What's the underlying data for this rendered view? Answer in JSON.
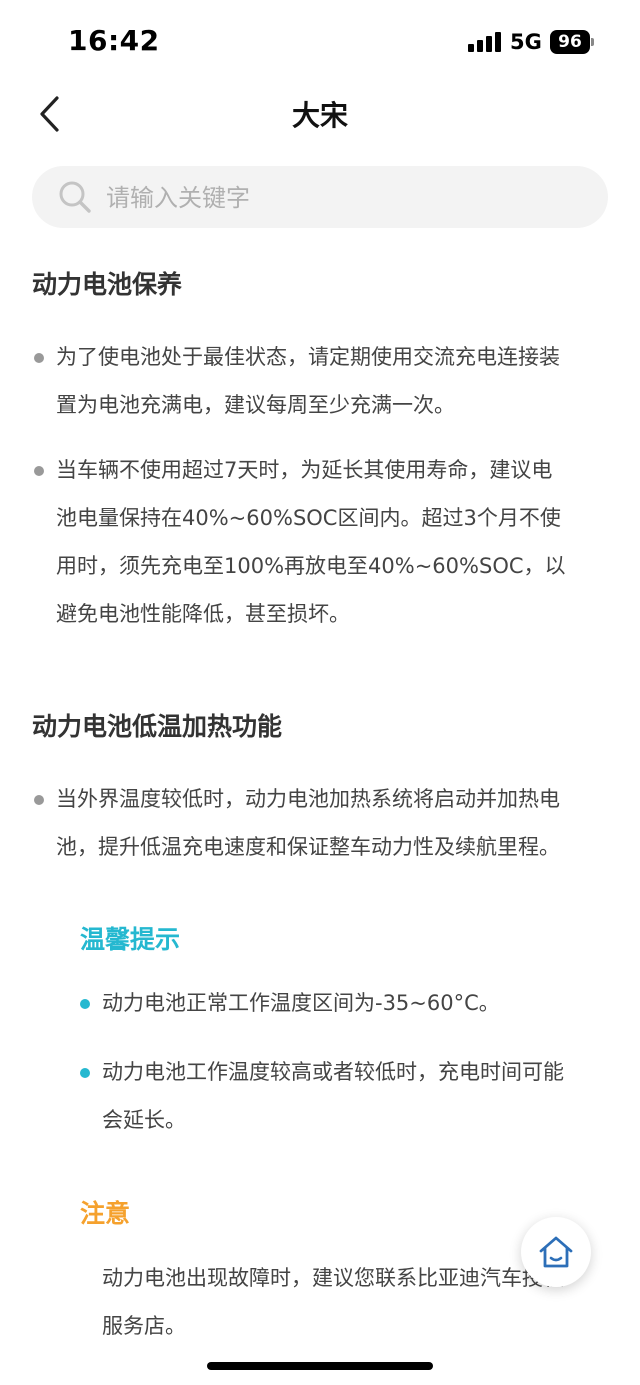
{
  "status_bar": {
    "time": "16:42",
    "network": "5G",
    "battery": "96"
  },
  "nav": {
    "title": "大宋"
  },
  "search": {
    "placeholder": "请输入关键字",
    "value": ""
  },
  "sections": [
    {
      "title": "动力电池保养",
      "bullets": [
        [
          "为了使电池处于最佳状态，请定期使用交流充电连接装",
          "置为电池充满电，建议每周至少充满一次。"
        ],
        [
          "当车辆不使用超过7天时，为延长其使用寿命，建议电",
          "池电量保持在40%~60%SOC区间内。超过3个月不使",
          "用时，须先充电至100%再放电至40%~60%SOC，以",
          "避免电池性能降低，甚至损坏。"
        ]
      ]
    },
    {
      "title": "动力电池低温加热功能",
      "bullets": [
        [
          "当外界温度较低时，动力电池加热系统将启动并加热电",
          "池，提升低温充电速度和保证整车动力性及续航里程。"
        ]
      ]
    }
  ],
  "tips": {
    "title": "温馨提示",
    "color": "#25b8d0",
    "bullets": [
      [
        "动力电池正常工作温度区间为-35~60°C。"
      ],
      [
        "动力电池工作温度较高或者较低时，充电时间可能",
        "会延长。"
      ]
    ]
  },
  "notice": {
    "title": "注意",
    "color": "#f5a12d",
    "bullets": [
      [
        "动力电池出现故障时，建议您联系比亚迪汽车授权",
        "服务店。"
      ]
    ]
  },
  "icons": {
    "back": "chevron-left-icon",
    "search": "search-icon",
    "home": "home-icon"
  }
}
